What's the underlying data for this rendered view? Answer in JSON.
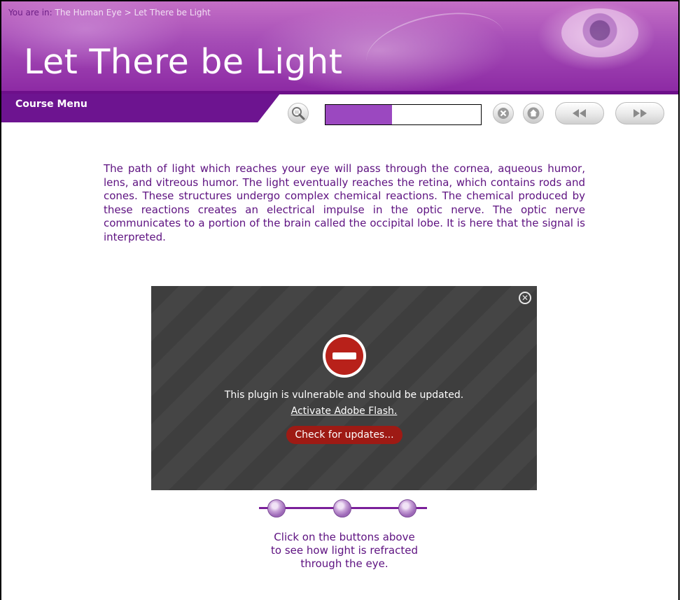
{
  "header": {
    "breadcrumb_prefix": "You are in:",
    "breadcrumb_path": "The Human Eye > Let There be Light",
    "title": "Let There be Light",
    "course_menu_label": "Course Menu"
  },
  "toolbar": {
    "icons": [
      "search-icon",
      "close-icon",
      "home-icon",
      "rewind-icon",
      "forward-icon"
    ],
    "progress_fraction": 0.43,
    "progress_color": "#9b48c0"
  },
  "content": {
    "paragraph": "The path of light which reaches your eye will pass through the cornea, aqueous humor, lens, and vitreous humor. The light eventually reaches the retina, which contains rods and cones. These structures undergo complex chemical reactions. The chemical produced by these reactions creates an electrical impulse in the optic nerve. The optic nerve communicates to a portion of the brain called the occipital lobe. It is here that the signal is interpreted."
  },
  "plugin": {
    "message": "This plugin is vulnerable and should be updated.",
    "activate_link": "Activate Adobe Flash.",
    "check_button": "Check for updates..."
  },
  "steps": {
    "count": 3
  },
  "caption": {
    "line1": "Click on the buttons above",
    "line2": "to see how light is refracted",
    "line3": "through the eye."
  },
  "colors": {
    "brand_purple": "#6d1490",
    "text_purple": "#5d1180",
    "alert_red": "#b8211a"
  }
}
